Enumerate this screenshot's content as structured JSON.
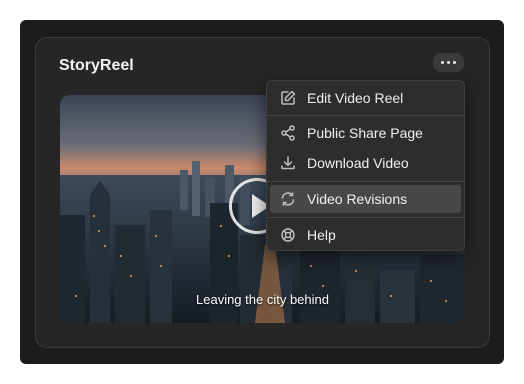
{
  "app": {
    "title": "StoryReel"
  },
  "video": {
    "caption": "Leaving the city behind"
  },
  "menu": {
    "items": [
      {
        "label": "Edit Video Reel",
        "icon": "edit-icon"
      },
      {
        "label": "Public Share Page",
        "icon": "share-icon"
      },
      {
        "label": "Download Video",
        "icon": "download-icon"
      },
      {
        "label": "Video Revisions",
        "icon": "revisions-icon",
        "active": true
      },
      {
        "label": "Help",
        "icon": "help-icon"
      }
    ]
  }
}
